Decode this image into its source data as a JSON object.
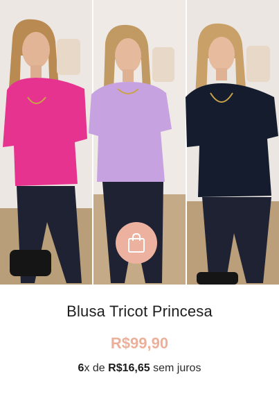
{
  "product": {
    "name": "Blusa Tricot Princesa",
    "price": "R$99,90",
    "installment": {
      "count": "6",
      "times": "x de ",
      "value": "R$16,65",
      "suffix": " sem juros"
    }
  },
  "actions": {
    "add_to_cart_icon": "shopping-bag-icon"
  },
  "colors": {
    "accent": "#edb19f",
    "price": "#ecb09a",
    "variant_pink": "#e6338f",
    "variant_lilac": "#c7a2e0",
    "variant_navy": "#141c2e"
  }
}
